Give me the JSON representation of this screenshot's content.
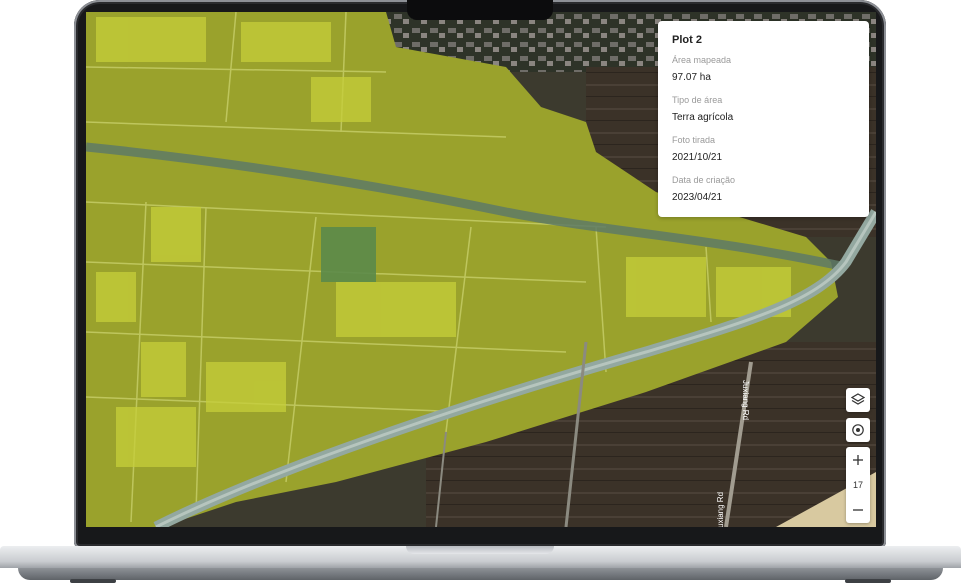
{
  "info_card": {
    "title": "Plot 2",
    "rows": [
      {
        "label": "Área mapeada",
        "value": "97.07 ha"
      },
      {
        "label": "Tipo de área",
        "value": "Terra agrícola"
      },
      {
        "label": "Foto tirada",
        "value": "2021/10/21"
      },
      {
        "label": "Data de criação",
        "value": "2023/04/21"
      }
    ]
  },
  "map": {
    "road_label_1": "Juxiang Rd",
    "road_label_2": "Juxiang Rd",
    "zoom_level": "17"
  },
  "controls": {
    "layers_icon": "layers-icon",
    "locate_icon": "locate-icon",
    "zoom_in_icon": "plus-icon",
    "zoom_out_icon": "minus-icon"
  },
  "colors": {
    "overlay": "#b8c414",
    "field_dark": "#5a5e3a",
    "road": "#8fa39a",
    "card_bg": "#ffffff"
  }
}
